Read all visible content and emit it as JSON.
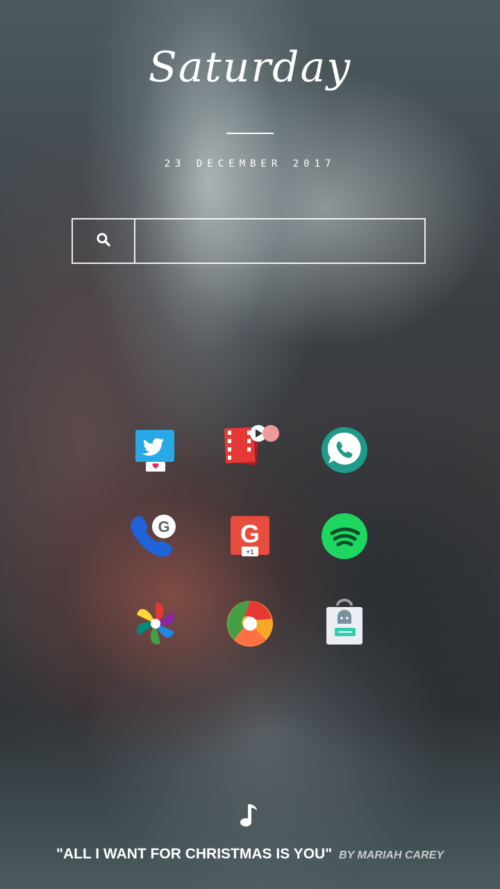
{
  "header": {
    "day": "Saturday",
    "date": "23 DECEMBER 2017"
  },
  "search": {
    "placeholder": "",
    "icon": "search-icon"
  },
  "apps": [
    {
      "name": "twitter-app",
      "icon": "twitter-bird-icon"
    },
    {
      "name": "video-player-app",
      "icon": "film-strip-icon",
      "badge": true
    },
    {
      "name": "whatsapp-app",
      "icon": "whatsapp-phone-icon"
    },
    {
      "name": "google-phone-app",
      "icon": "phone-handset-g-icon"
    },
    {
      "name": "google-plus-app",
      "icon": "google-plus-icon",
      "text": "+1"
    },
    {
      "name": "spotify-app",
      "icon": "spotify-icon"
    },
    {
      "name": "google-photos-app",
      "icon": "pinwheel-icon"
    },
    {
      "name": "chrome-app",
      "icon": "chrome-swirl-icon"
    },
    {
      "name": "play-store-app",
      "icon": "android-bag-icon"
    }
  ],
  "now_playing": {
    "icon": "music-note-icon",
    "title": "\"ALL I WANT FOR CHRISTMAS IS YOU\"",
    "artist": "BY MARIAH CAREY"
  },
  "colors": {
    "twitter": "#1da1f2",
    "video": "#e53935",
    "whatsapp": "#26a69a",
    "phone": "#1e63d8",
    "gplus": "#e84c3d",
    "spotify": "#1ed760"
  }
}
